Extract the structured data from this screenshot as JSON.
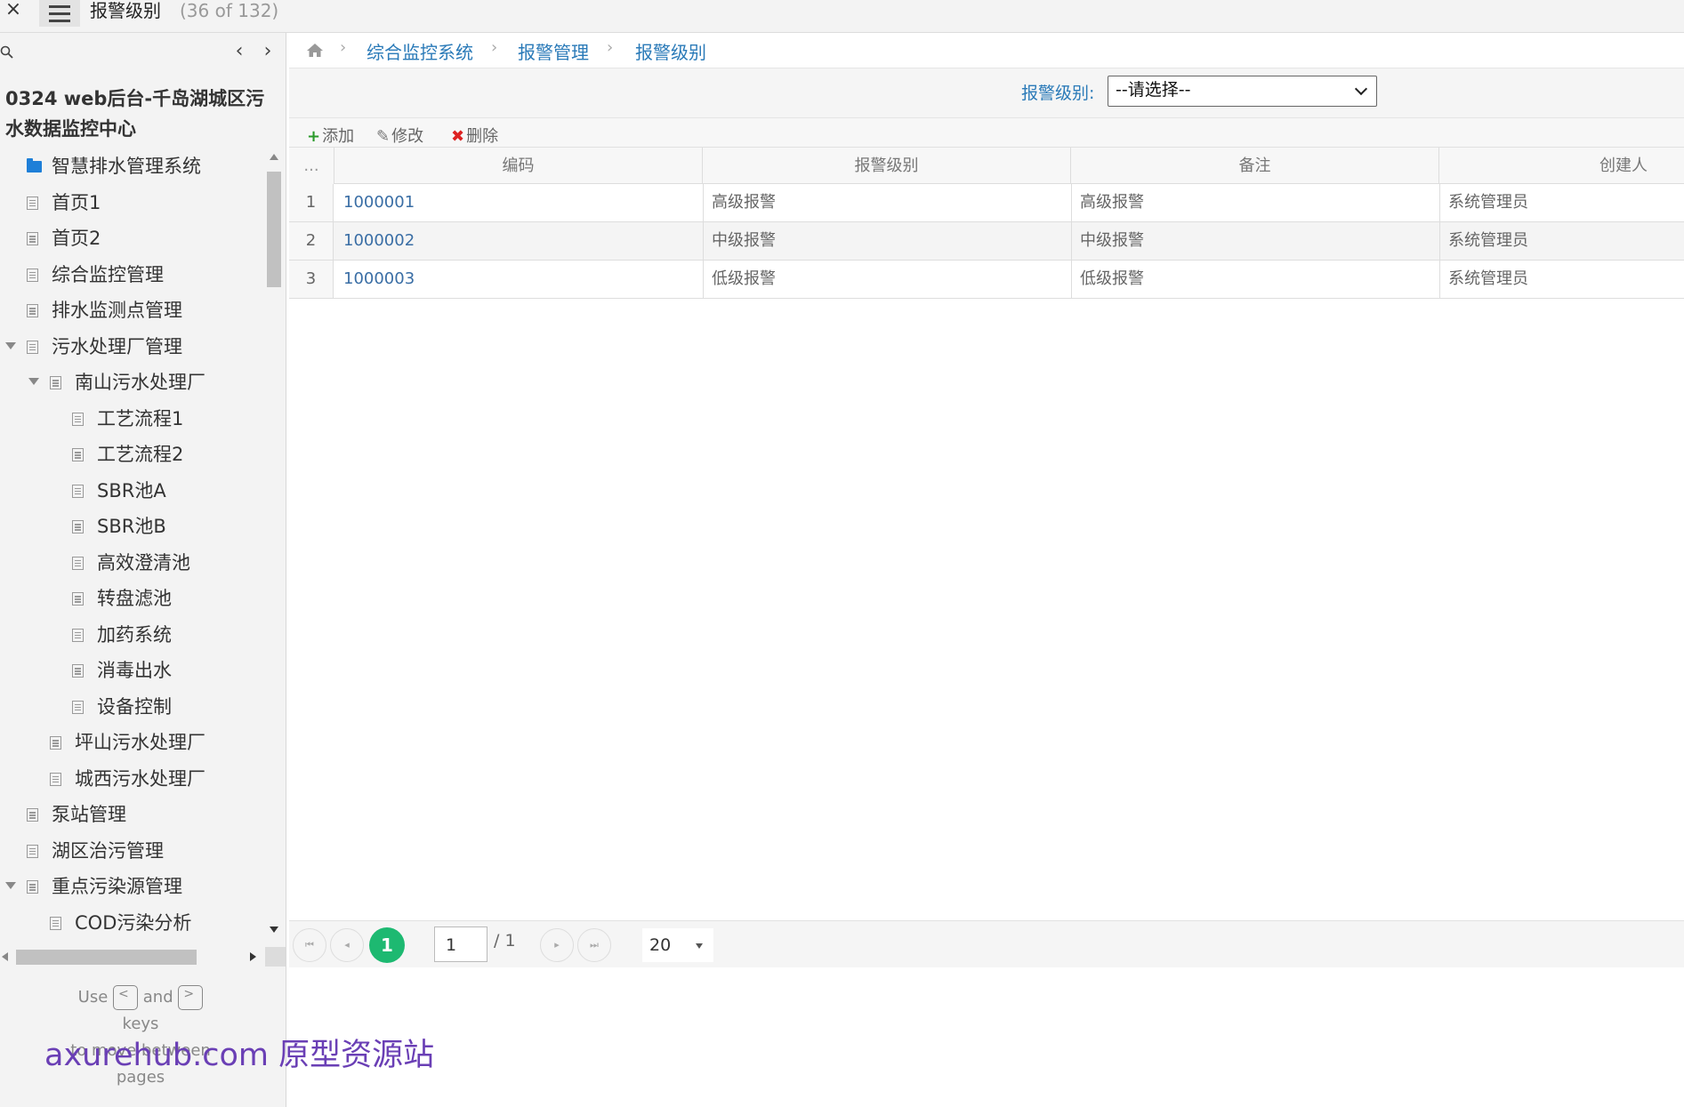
{
  "topbar": {
    "close_label": "×",
    "page_title": "报警级别",
    "page_count": "(36 of 132)"
  },
  "sidebar": {
    "project_title": "0324 web后台-千岛湖城区污水数据监控中心",
    "tree": [
      {
        "label": "智慧排水管理系统",
        "icon": "folder-icon",
        "level": 0,
        "expanded": false
      },
      {
        "label": "首页1",
        "icon": "page-icon",
        "level": 0
      },
      {
        "label": "首页2",
        "icon": "page-icon",
        "level": 0
      },
      {
        "label": "综合监控管理",
        "icon": "page-icon",
        "level": 0
      },
      {
        "label": "排水监测点管理",
        "icon": "page-icon",
        "level": 0
      },
      {
        "label": "污水处理厂管理",
        "icon": "page-icon",
        "level": 0,
        "expanded": true
      },
      {
        "label": "南山污水处理厂",
        "icon": "page-icon",
        "level": 1,
        "expanded": true
      },
      {
        "label": "工艺流程1",
        "icon": "page-icon",
        "level": 2
      },
      {
        "label": "工艺流程2",
        "icon": "page-icon",
        "level": 2
      },
      {
        "label": "SBR池A",
        "icon": "page-icon",
        "level": 2
      },
      {
        "label": "SBR池B",
        "icon": "page-icon",
        "level": 2
      },
      {
        "label": "高效澄清池",
        "icon": "page-icon",
        "level": 2
      },
      {
        "label": "转盘滤池",
        "icon": "page-icon",
        "level": 2
      },
      {
        "label": "加药系统",
        "icon": "page-icon",
        "level": 2
      },
      {
        "label": "消毒出水",
        "icon": "page-icon",
        "level": 2
      },
      {
        "label": "设备控制",
        "icon": "page-icon",
        "level": 2
      },
      {
        "label": "坪山污水处理厂",
        "icon": "page-icon",
        "level": 1
      },
      {
        "label": "城西污水处理厂",
        "icon": "page-icon",
        "level": 1
      },
      {
        "label": "泵站管理",
        "icon": "page-icon",
        "level": 0
      },
      {
        "label": "湖区治污管理",
        "icon": "page-icon",
        "level": 0
      },
      {
        "label": "重点污染源管理",
        "icon": "page-icon",
        "level": 0,
        "expanded": true
      },
      {
        "label": "COD污染分析",
        "icon": "page-icon",
        "level": 1
      }
    ],
    "hint": {
      "use": "Use",
      "key_prev": "<",
      "and": "and",
      "key_next": ">",
      "keys": "keys",
      "line2": "to move between",
      "line3": "pages"
    },
    "watermark": "axurehub.com 原型资源站"
  },
  "breadcrumb": {
    "home_icon": "home-icon",
    "items": [
      "综合监控系统",
      "报警管理",
      "报警级别"
    ]
  },
  "filter": {
    "label": "报警级别:",
    "selected": "--请选择--"
  },
  "toolbar": {
    "add": "添加",
    "edit": "修改",
    "delete": "删除",
    "add_icon": "+",
    "edit_icon": "✎",
    "delete_icon": "✖"
  },
  "grid": {
    "rownum_header": "...",
    "columns": [
      "编码",
      "报警级别",
      "备注",
      "创建人"
    ],
    "rows": [
      {
        "num": "1",
        "code": "1000001",
        "level": "高级报警",
        "note": "高级报警",
        "creator": "系统管理员"
      },
      {
        "num": "2",
        "code": "1000002",
        "level": "中级报警",
        "note": "中级报警",
        "creator": "系统管理员"
      },
      {
        "num": "3",
        "code": "1000003",
        "level": "低级报警",
        "note": "低级报警",
        "creator": "系统管理员"
      }
    ]
  },
  "pager": {
    "current_page": "1",
    "page_input": "1",
    "total": "/ 1",
    "page_size": "20"
  },
  "colors": {
    "accent": "#2a7ab8",
    "pager_active": "#1db971",
    "delete": "#dd2222",
    "add": "#2a9a2a",
    "folder": "#1e7fd8"
  }
}
